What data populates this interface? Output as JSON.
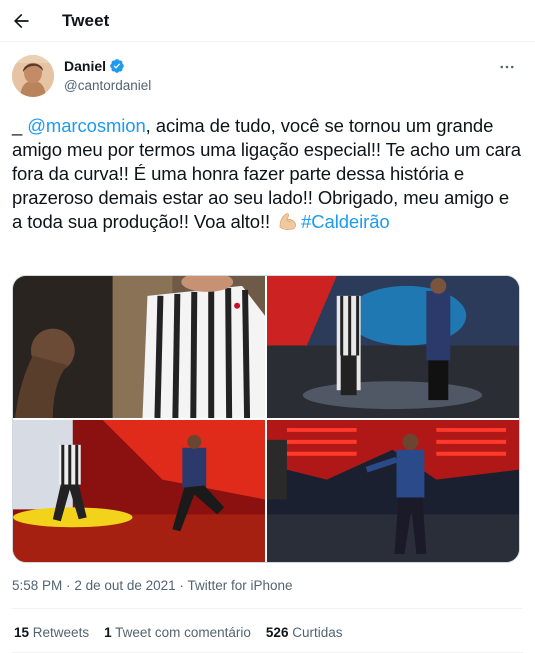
{
  "header": {
    "title": "Tweet",
    "back_icon": "arrow-left-icon"
  },
  "author": {
    "display_name": "Daniel",
    "handle": "@cantordaniel",
    "verified_icon": "verified-badge-icon",
    "more_icon": "more-horizontal-icon"
  },
  "tweet": {
    "prefix": "_ ",
    "mention": "@marcosmion",
    "body": ", acima de tudo, você se tornou um grande amigo meu por termos uma ligação especial!! Te acho um cara fora da curva!! É uma honra fazer parte dessa história e prazeroso demais estar ao seu lado!! Obrigado, meu amigo e a toda sua produção!! Voa alto!! ",
    "emoji_icon": "flexed-biceps-icon",
    "hashtag": "#Caldeirão"
  },
  "media": {
    "count": 4
  },
  "meta": {
    "time": "5:58 PM",
    "date": "2 de out de 2021",
    "dot": "·",
    "source": "Twitter for iPhone"
  },
  "stats": {
    "retweets_count": "15",
    "retweets_label": "Retweets",
    "quotes_count": "1",
    "quotes_label": "Tweet com comentário",
    "likes_count": "526",
    "likes_label": "Curtidas"
  },
  "colors": {
    "accent": "#1d9bf0",
    "text": "#0f1419",
    "secondary": "#536471",
    "border": "#eff3f4"
  }
}
